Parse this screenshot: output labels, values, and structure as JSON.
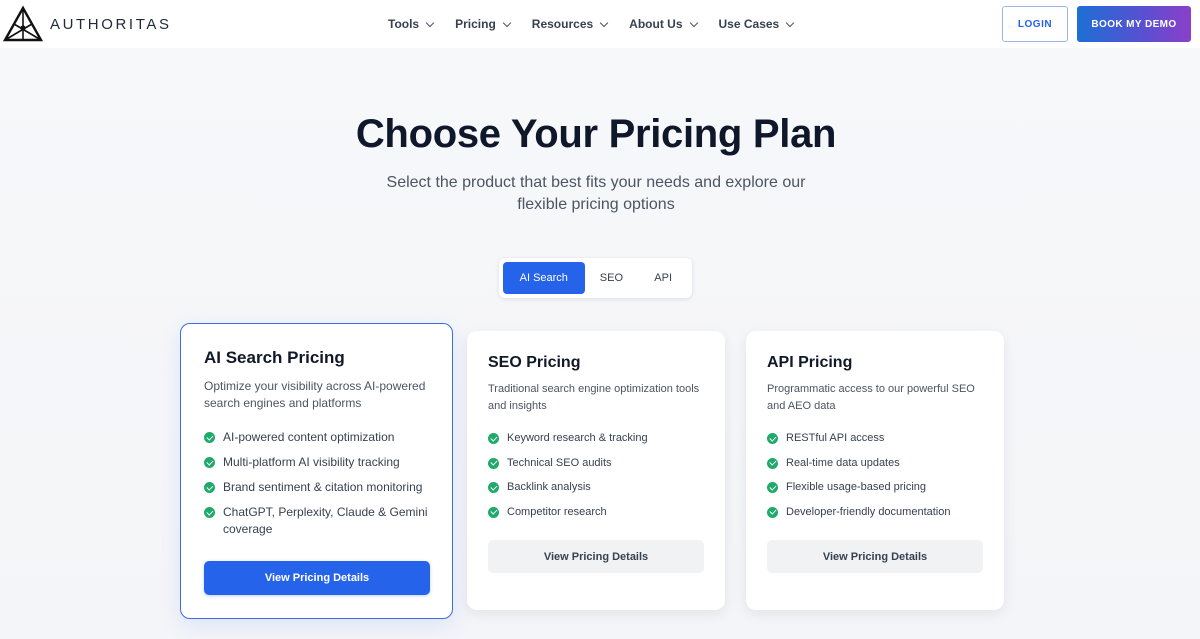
{
  "header": {
    "logo_text": "AUTHORITAS",
    "nav": [
      {
        "label": "Tools"
      },
      {
        "label": "Pricing"
      },
      {
        "label": "Resources"
      },
      {
        "label": "About Us"
      },
      {
        "label": "Use Cases"
      }
    ],
    "login_label": "LOGIN",
    "demo_label": "BOOK MY DEMO"
  },
  "hero": {
    "title": "Choose Your Pricing Plan",
    "subtitle_line1": "Select the product that best fits your needs and explore our",
    "subtitle_line2": "flexible pricing options"
  },
  "tabs": [
    {
      "label": "AI Search",
      "active": true
    },
    {
      "label": "SEO",
      "active": false
    },
    {
      "label": "API",
      "active": false
    }
  ],
  "cards": [
    {
      "title": "AI Search Pricing",
      "description": "Optimize your visibility across AI-powered search engines and platforms",
      "features": [
        "AI-powered content optimization",
        "Multi-platform AI visibility tracking",
        "Brand sentiment & citation monitoring",
        "ChatGPT, Perplexity, Claude & Gemini coverage"
      ],
      "button": "View Pricing Details"
    },
    {
      "title": "SEO Pricing",
      "description": "Traditional search engine optimization tools and insights",
      "features": [
        "Keyword research & tracking",
        "Technical SEO audits",
        "Backlink analysis",
        "Competitor research"
      ],
      "button": "View Pricing Details"
    },
    {
      "title": "API Pricing",
      "description": "Programmatic access to our powerful SEO and AEO data",
      "features": [
        "RESTful API access",
        "Real-time data updates",
        "Flexible usage-based pricing",
        "Developer-friendly documentation"
      ],
      "button": "View Pricing Details"
    }
  ],
  "colors": {
    "primary": "#2563eb",
    "check": "#1faa6b",
    "heading": "#0f172a"
  }
}
